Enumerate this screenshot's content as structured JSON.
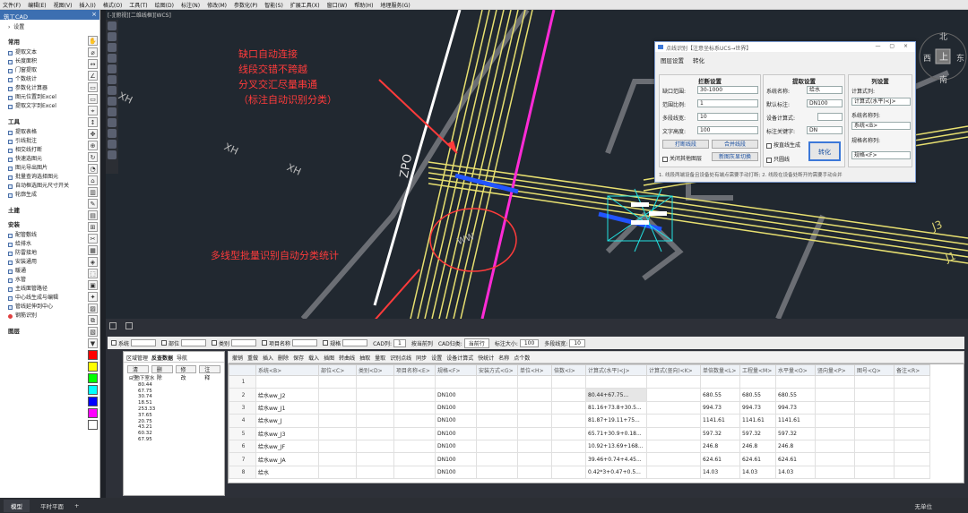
{
  "menu": [
    "文件(F)",
    "编辑(E)",
    "视图(V)",
    "插入(I)",
    "格式(O)",
    "工具(T)",
    "绘图(D)",
    "标注(N)",
    "修改(M)",
    "参数化(P)",
    "智能(S)",
    "扩展工具(X)",
    "窗口(W)",
    "帮助(H)",
    "地理服务(G)"
  ],
  "sidebar": {
    "title": "筑工CAD",
    "settings": "设置",
    "common_title": "常用",
    "common": [
      "提取文本",
      "长度面积",
      "门窗提取",
      "个数统计",
      "参数化计算器",
      "图元位置到Excel",
      "提取文字到Excel"
    ],
    "tools_title": "工具",
    "tools": [
      "提取表格",
      "引线批注",
      "相交线打断",
      "快速选图元",
      "图元导出图片",
      "批量查询选择图元",
      "自动框选图元尺寸开关",
      "轮廓生成"
    ],
    "civil_title": "土建",
    "install_title": "安装",
    "install": [
      "配管敷线",
      "给排水",
      "防雷接地",
      "安装通用",
      "暖通",
      "水管",
      "主线面管路径",
      "中心线生成与编辑",
      "管线延伸到中心",
      "钢筋识别"
    ],
    "layer_title": "图层"
  },
  "cad": {
    "view_tag": "[-][俯视][二维线框][WCS]",
    "annotation1": [
      "缺口自动连接",
      "线段交错不跨越",
      "分叉交汇尽量串通",
      "（标注自动识别分类）"
    ],
    "annotation2": "多线型批量识别自动分类统计",
    "labels": {
      "xh": "XH",
      "zpo": "ZPO",
      "j3": "J3",
      "j1": "J1",
      "ww": "WW"
    },
    "compass": [
      "北",
      "上",
      "南",
      "西",
      "东"
    ]
  },
  "dialog": {
    "title": "点线识别【注意坐标系UCS→世界】",
    "tabs": [
      "图层设置",
      "转化"
    ],
    "break_group": "拦断设置",
    "break_fields": [
      {
        "label": "缺口范围:",
        "value": "30-1000"
      },
      {
        "label": "范围比例:",
        "value": "1"
      },
      {
        "label": "多段线宽:",
        "value": "10"
      },
      {
        "label": "文字高度:",
        "value": "100"
      }
    ],
    "btn_break": "打断线段",
    "btn_merge": "合并线段",
    "chk_close_other": "关闭其他图层",
    "btn_new_layer": "新图灰显切换",
    "extract_group": "提取设置",
    "extract_fields": [
      {
        "label": "系统名称:",
        "value": "给水"
      },
      {
        "label": "默认标注:",
        "value": "DN100"
      },
      {
        "label": "设备计算式:",
        "value": ""
      },
      {
        "label": "标注关键字:",
        "value": "DN"
      }
    ],
    "chk_by_line": "按直线生成",
    "chk_only_circle": "只圆线",
    "btn_convert": "转化",
    "col_group": "列设置",
    "col_formula_label": "计算式列:",
    "col_formula_value": "计算式(水平)<J>",
    "col_sys_label": "系统名称列:",
    "col_sys_value": "系统<B>",
    "col_spec_label": "规格名称列:",
    "col_spec_value": "规格<F>",
    "note": "1. 线段两端设备且设备处有端点需要手动打断; 2. 线段在设备处断开的需要手动合并"
  },
  "panel": {
    "filters": [
      {
        "label": "系统"
      },
      {
        "label": "部位"
      },
      {
        "label": "类别"
      },
      {
        "label": "项目名称"
      },
      {
        "label": "规格"
      }
    ],
    "cad_col_label": "CAD列:",
    "cad_col_value": "1",
    "chk_by_column": "按当前列",
    "cad_mode_label": "CAD归类:",
    "cad_mode_value": "当前行",
    "font_label": "标注大小:",
    "font_value": "100",
    "decimals_label": "多段线宽:",
    "decimals_value": "10",
    "left_tabs": [
      "区域管理",
      "反查数据",
      "导航"
    ],
    "left_btns": [
      "清空",
      "删除",
      "修改",
      "注释"
    ],
    "tree_root": "地下室水",
    "tree_leaves": [
      "80.44",
      "67.75",
      "30.74",
      "18.51",
      "253.33",
      "37.65",
      "20.75",
      "43.21",
      "60.32",
      "67.95"
    ],
    "tools": [
      "撤销",
      "重做",
      "插入",
      "删除",
      "保存",
      "载入",
      "插图",
      "转曲线",
      "抽取",
      "量取",
      "识别点线",
      "同步",
      "设置",
      "设备计算式",
      "快统计",
      "名称",
      "点个数"
    ],
    "columns": [
      "",
      "系统<B>",
      "部位<C>",
      "类别<D>",
      "项目名称<E>",
      "规格<F>",
      "安装方式<G>",
      "单位<H>",
      "倍数<I>",
      "计算式(水平)<J>",
      "计算式(竖向)<K>",
      "单倍数量<L>",
      "工程量<M>",
      "水平量<O>",
      "竖向量<P>",
      "图号<Q>",
      "备注<R>"
    ],
    "rows": [
      [
        "1",
        "",
        "",
        "",
        "",
        "",
        "",
        "",
        "",
        "",
        "",
        "",
        "",
        "",
        "",
        "",
        ""
      ],
      [
        "2",
        "给水ww_J2",
        "",
        "",
        "",
        "DN100",
        "",
        "",
        "",
        "80.44+67.75...",
        "",
        "680.55",
        "680.55",
        "680.55",
        "",
        "",
        ""
      ],
      [
        "3",
        "给水ww_J1",
        "",
        "",
        "",
        "DN100",
        "",
        "",
        "",
        "81.16+73.8+30.5...",
        "",
        "994.73",
        "994.73",
        "994.73",
        "",
        "",
        ""
      ],
      [
        "4",
        "给水ww_J",
        "",
        "",
        "",
        "DN100",
        "",
        "",
        "",
        "81.87+19.11+75...",
        "",
        "1141.61",
        "1141.61",
        "1141.61",
        "",
        "",
        ""
      ],
      [
        "5",
        "给水ww_J3",
        "",
        "",
        "",
        "DN100",
        "",
        "",
        "",
        "65.71+30.9+0.18...",
        "",
        "597.32",
        "597.32",
        "597.32",
        "",
        "",
        ""
      ],
      [
        "6",
        "给水ww_JF",
        "",
        "",
        "",
        "DN100",
        "",
        "",
        "",
        "10.92+13.69+168...",
        "",
        "246.8",
        "246.8",
        "246.8",
        "",
        "",
        ""
      ],
      [
        "7",
        "给水ww_JA",
        "",
        "",
        "",
        "DN100",
        "",
        "",
        "",
        "39.46+0.74+4.45...",
        "",
        "624.61",
        "624.61",
        "624.61",
        "",
        "",
        ""
      ],
      [
        "8",
        "给水",
        "",
        "",
        "",
        "DN100",
        "",
        "",
        "",
        "0.42*3+0.47+0.5...",
        "",
        "14.03",
        "14.03",
        "14.03",
        "",
        "",
        ""
      ]
    ]
  },
  "statusbar": {
    "tabs": [
      "模型",
      "平时平面"
    ],
    "plus": "+",
    "right": "无单位"
  },
  "colors": {
    "annotation": "#ff3b3b",
    "pipe_yellow": "#e8e070",
    "pipe_magenta": "#ff2bd6",
    "pipe_white": "#ffffff",
    "pipe_blue": "#2255ff",
    "equip_cyan": "#22e0e0"
  }
}
